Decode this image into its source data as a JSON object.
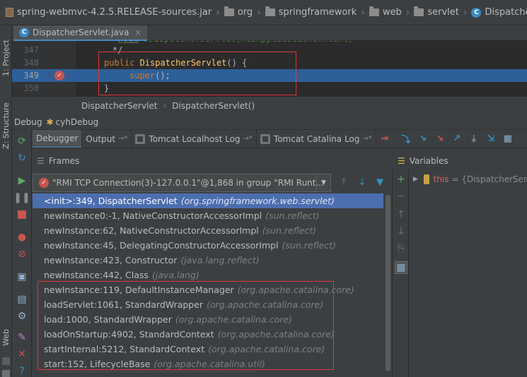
{
  "breadcrumb": {
    "items": [
      "spring-webmvc-4.2.5.RELEASE-sources.jar",
      "org",
      "springframework",
      "web",
      "servlet",
      "DispatcherServlet"
    ]
  },
  "left_strip": {
    "project_tab": "1: Project",
    "structure_tab": "Z: Structure",
    "web_tab": "Web"
  },
  "editor": {
    "tab_label": "DispatcherServlet.java",
    "lines": [
      {
        "num": "347",
        "text": "*/"
      },
      {
        "num": "348",
        "text": "public DispatcherServlet() {"
      },
      {
        "num": "349",
        "text": "super();"
      },
      {
        "num": "350",
        "text": "}"
      }
    ],
    "breadcrumb": [
      "DispatcherServlet",
      "DispatcherServlet()"
    ]
  },
  "debug": {
    "title": "Debug",
    "config_name": "cyhDebug",
    "tabs": [
      "Debugger",
      "Output",
      "Tomcat Localhost Log",
      "Tomcat Catalina Log"
    ],
    "frames_title": "Frames",
    "variables_title": "Variables",
    "thread": "\"RMI TCP Connection(3)-127.0.0.1\"@1,868 in group \"RMI Runt...",
    "frames": [
      {
        "method": "<init>:349, DispatcherServlet",
        "pkg": "(org.springframework.web.servlet)"
      },
      {
        "method": "newInstance0:-1, NativeConstructorAccessorImpl",
        "pkg": "(sun.reflect)"
      },
      {
        "method": "newInstance:62, NativeConstructorAccessorImpl",
        "pkg": "(sun.reflect)"
      },
      {
        "method": "newInstance:45, DelegatingConstructorAccessorImpl",
        "pkg": "(sun.reflect)"
      },
      {
        "method": "newInstance:423, Constructor",
        "pkg": "(java.lang.reflect)"
      },
      {
        "method": "newInstance:442, Class",
        "pkg": "(java.lang)"
      },
      {
        "method": "newInstance:119, DefaultInstanceManager",
        "pkg": "(org.apache.catalina.core)"
      },
      {
        "method": "loadServlet:1061, StandardWrapper",
        "pkg": "(org.apache.catalina.core)"
      },
      {
        "method": "load:1000, StandardWrapper",
        "pkg": "(org.apache.catalina.core)"
      },
      {
        "method": "loadOnStartup:4902, StandardContext",
        "pkg": "(org.apache.catalina.core)"
      },
      {
        "method": "startInternal:5212, StandardContext",
        "pkg": "(org.apache.catalina.core)"
      },
      {
        "method": "start:152, LifecycleBase",
        "pkg": "(org.apache.catalina.util)"
      }
    ],
    "variable": {
      "name": "this",
      "value": "= {DispatcherSer"
    }
  },
  "colors": {
    "background": "#3c3f41",
    "editor_bg": "#2b2b2b",
    "selection": "#4b6eaf",
    "highlight_line": "#2d6099",
    "annotation": "#e0363c",
    "keyword": "#cc7832",
    "method": "#ffc66d"
  }
}
